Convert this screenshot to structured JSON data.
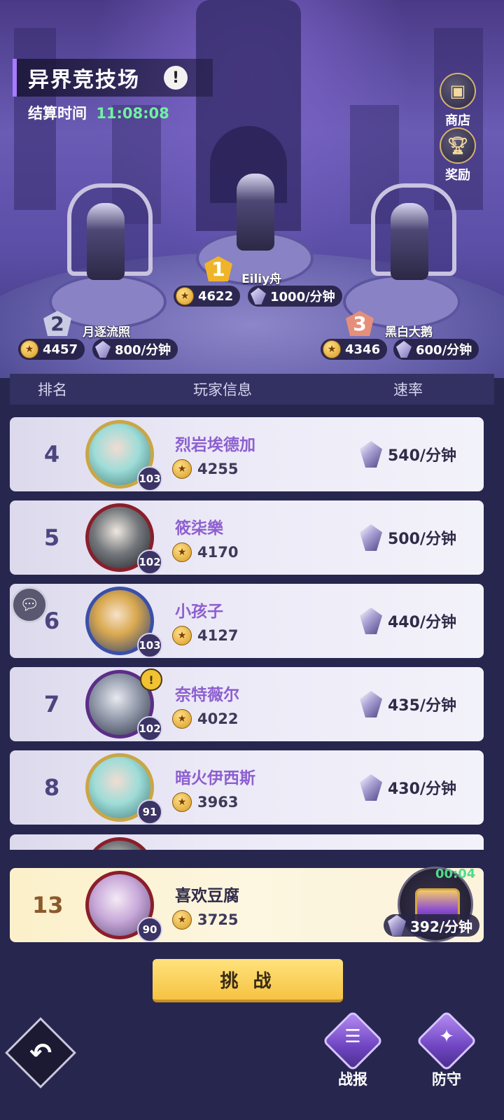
{
  "header": {
    "title": "异界竞技场",
    "info_label": "!",
    "settle_label": "结算时间",
    "settle_time": "11:08:08"
  },
  "side_buttons": {
    "shop_label": "商店",
    "reward_label": "奖励"
  },
  "podium": {
    "first": {
      "rank": "1",
      "name": "Eiliy舟",
      "score": "4622",
      "rate": "1000/分钟"
    },
    "second": {
      "rank": "2",
      "name": "月逐流照",
      "score": "4457",
      "rate": "800/分钟"
    },
    "third": {
      "rank": "3",
      "name": "黑白大鹅",
      "score": "4346",
      "rate": "600/分钟"
    }
  },
  "table_header": {
    "rank": "排名",
    "player": "玩家信息",
    "rate": "速率"
  },
  "rows": [
    {
      "rank": "4",
      "name": "烈岩埃德加",
      "score": "4255",
      "rate": "540/分钟",
      "level": "103"
    },
    {
      "rank": "5",
      "name": "筱柒樂",
      "score": "4170",
      "rate": "500/分钟",
      "level": "102"
    },
    {
      "rank": "6",
      "name": "小孩子",
      "score": "4127",
      "rate": "440/分钟",
      "level": "103"
    },
    {
      "rank": "7",
      "name": "奈特薇尔",
      "score": "4022",
      "rate": "435/分钟",
      "level": "102"
    },
    {
      "rank": "8",
      "name": "暗火伊西斯",
      "score": "3963",
      "rate": "430/分钟",
      "level": "91"
    }
  ],
  "me": {
    "rank": "13",
    "name": "喜欢豆腐",
    "score": "3725",
    "rate": "392/分钟",
    "level": "90",
    "chest_timer": "00:04"
  },
  "actions": {
    "challenge_label": "挑 战",
    "battle_report_label": "战报",
    "defense_label": "防守"
  },
  "colors": {
    "accent_purple": "#a77bff",
    "timer_green": "#6ff2a0",
    "challenge_yellow": "#f6c343"
  }
}
